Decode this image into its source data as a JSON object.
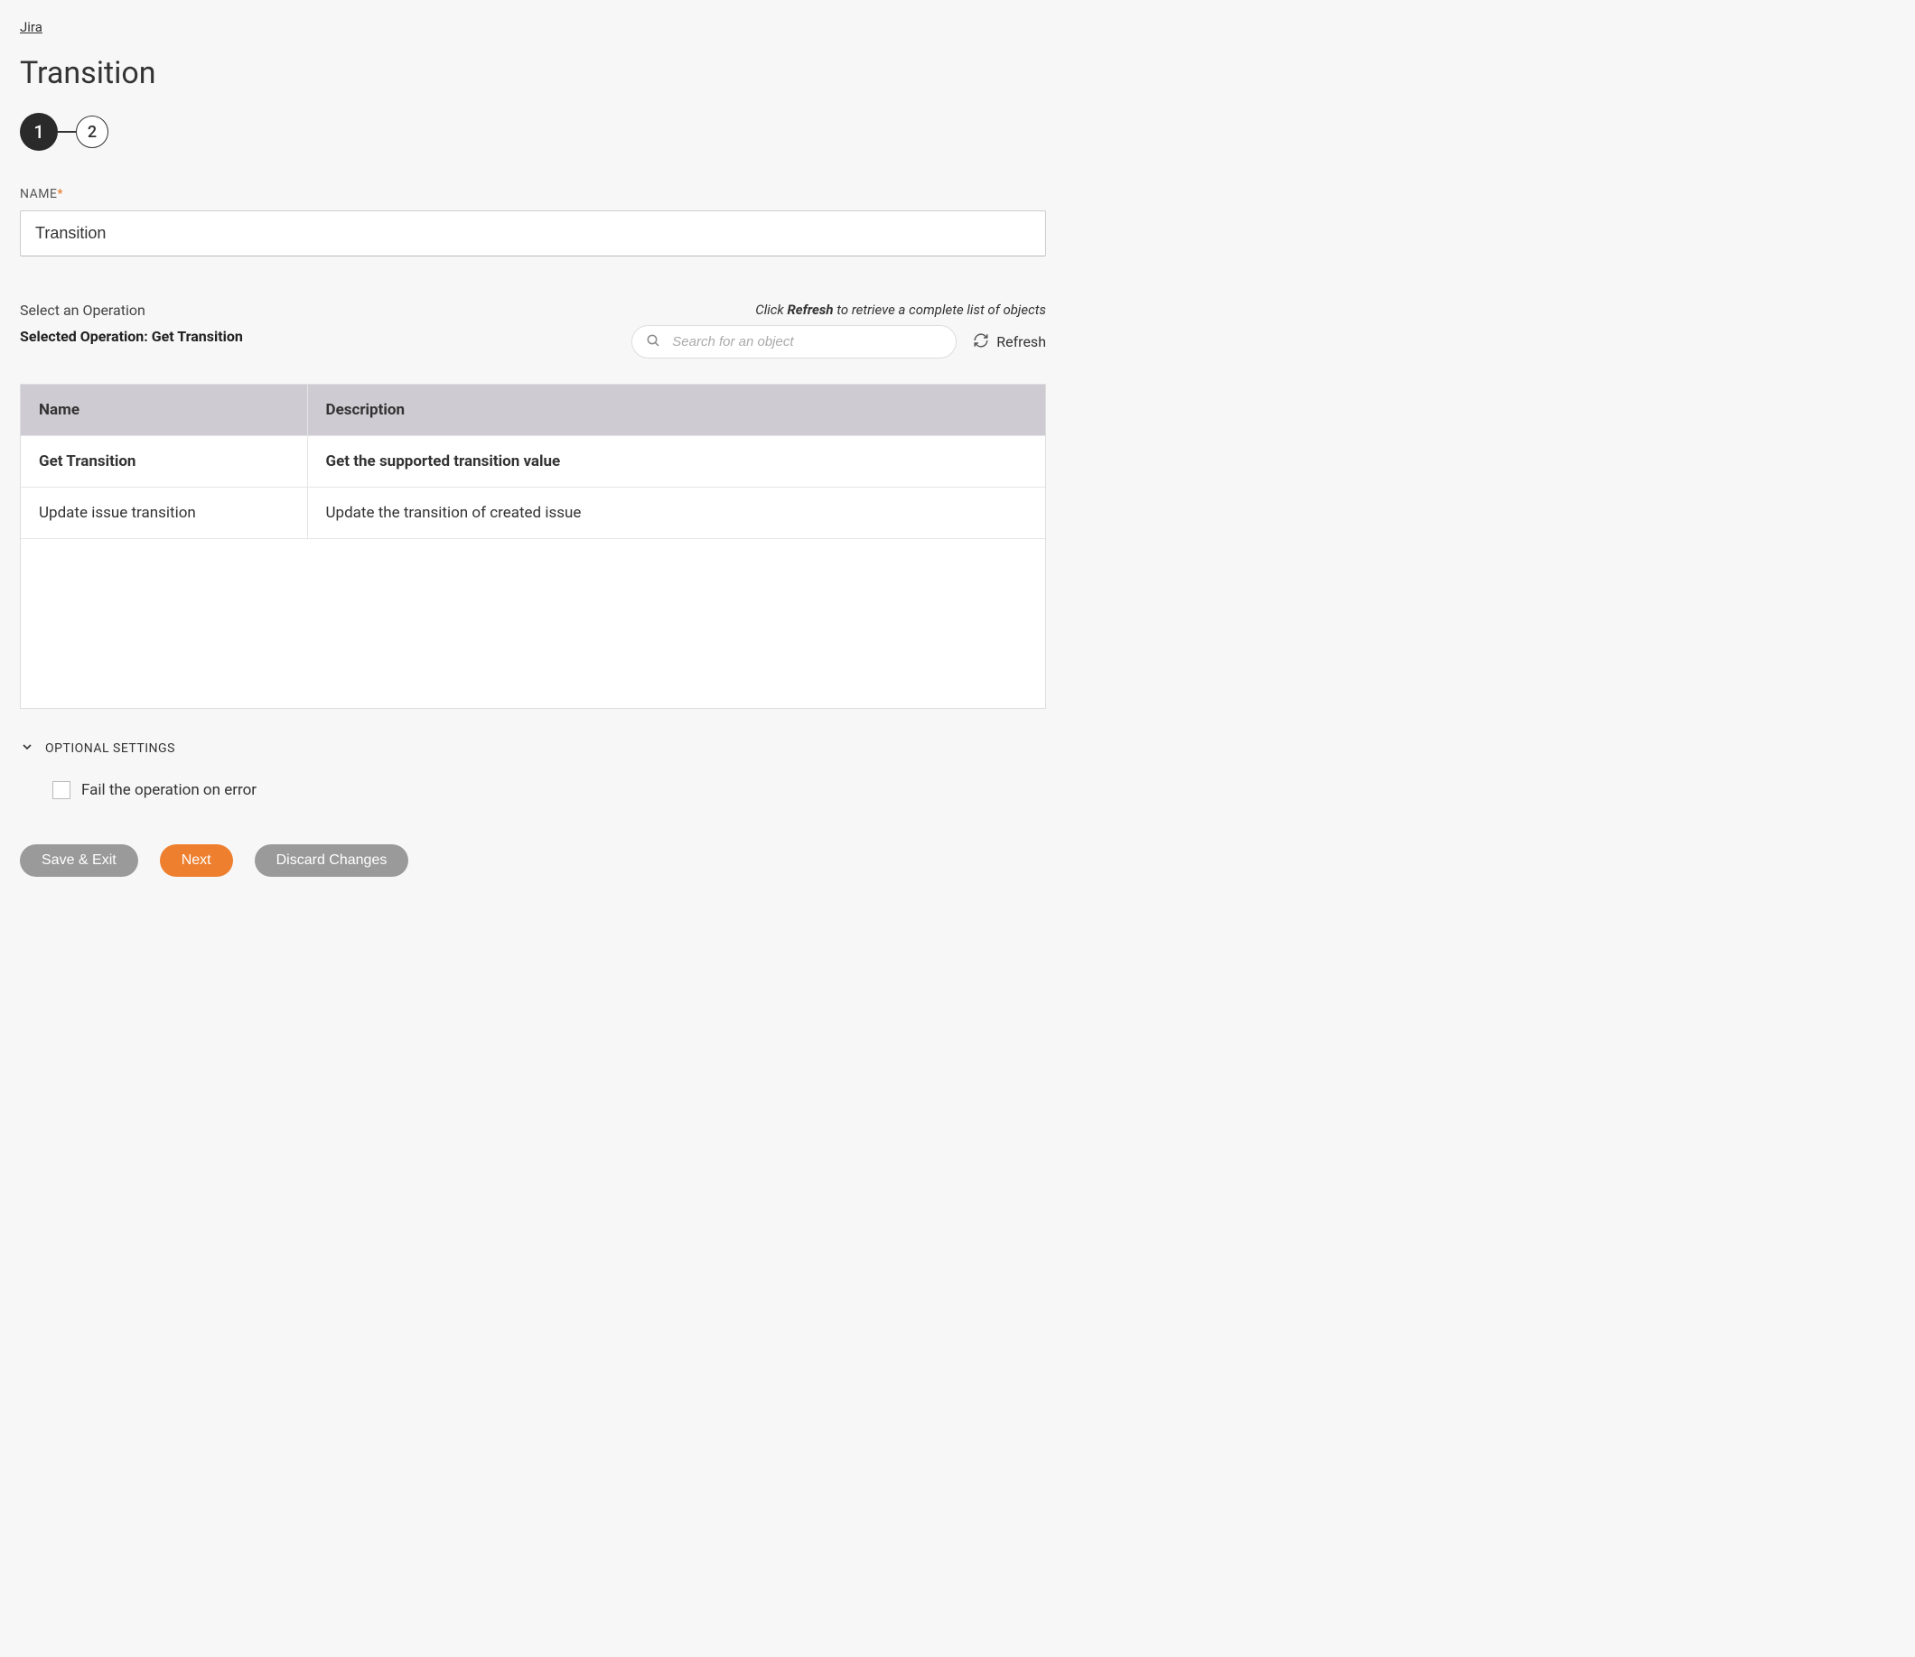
{
  "breadcrumb": {
    "label": "Jira"
  },
  "page_title": "Transition",
  "stepper": {
    "steps": [
      "1",
      "2"
    ],
    "active_index": 0
  },
  "name_field": {
    "label": "NAME",
    "required_mark": "*",
    "value": "Transition"
  },
  "operation": {
    "select_label": "Select an Operation",
    "selected_prefix": "Selected Operation: ",
    "selected_value": "Get Transition",
    "hint_prefix": "Click ",
    "hint_bold": "Refresh",
    "hint_suffix": " to retrieve a complete list of objects",
    "search_placeholder": "Search for an object",
    "refresh_label": "Refresh",
    "table": {
      "headers": {
        "name": "Name",
        "description": "Description"
      },
      "rows": [
        {
          "name": "Get Transition",
          "description": "Get the supported transition value",
          "selected": true
        },
        {
          "name": "Update issue transition",
          "description": "Update the transition of created issue",
          "selected": false
        }
      ]
    }
  },
  "optional": {
    "label": "OPTIONAL SETTINGS",
    "checkbox_label": "Fail the operation on error",
    "checked": false
  },
  "buttons": {
    "save_exit": "Save & Exit",
    "next": "Next",
    "discard": "Discard Changes"
  }
}
